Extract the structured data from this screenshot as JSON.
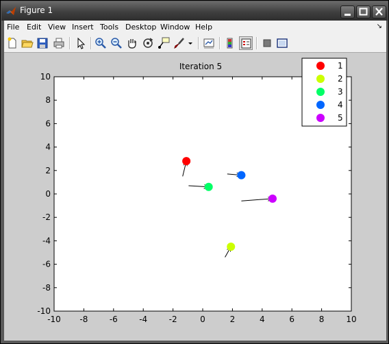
{
  "window": {
    "title": "Figure 1"
  },
  "menubar": {
    "items": [
      "File",
      "Edit",
      "View",
      "Insert",
      "Tools",
      "Desktop",
      "Window",
      "Help"
    ]
  },
  "toolbar": {
    "buttons": [
      "new-figure",
      "open-file",
      "save-figure",
      "print-figure",
      "edit-plot",
      "zoom-in",
      "zoom-out",
      "pan",
      "rotate-3d",
      "data-cursor",
      "brush",
      "brush-dropdown",
      "link-plot",
      "insert-colorbar",
      "insert-legend",
      "hide-plot-tools",
      "show-plot-tools"
    ]
  },
  "chart_data": {
    "type": "scatter",
    "title": "Iteration 5",
    "xlabel": "",
    "ylabel": "",
    "xlim": [
      -10,
      10
    ],
    "ylim": [
      -10,
      10
    ],
    "xticks": [
      -10,
      -8,
      -6,
      -4,
      -2,
      0,
      2,
      4,
      6,
      8,
      10
    ],
    "yticks": [
      -10,
      -8,
      -6,
      -4,
      -2,
      0,
      2,
      4,
      6,
      8,
      10
    ],
    "grid": false,
    "legend_position": "top-right",
    "series": [
      {
        "name": "1",
        "color": "#ff0000",
        "x": -1.1,
        "y": 2.8,
        "arrow_from": [
          -1.35,
          1.5
        ]
      },
      {
        "name": "2",
        "color": "#ccff00",
        "x": 1.9,
        "y": -4.5,
        "arrow_from": [
          1.5,
          -5.4
        ]
      },
      {
        "name": "3",
        "color": "#00ff66",
        "x": 0.4,
        "y": 0.6,
        "arrow_from": [
          -0.95,
          0.7
        ]
      },
      {
        "name": "4",
        "color": "#0066ff",
        "x": 2.6,
        "y": 1.6,
        "arrow_from": [
          1.65,
          1.7
        ]
      },
      {
        "name": "5",
        "color": "#cc00ff",
        "x": 4.7,
        "y": -0.4,
        "arrow_from": [
          2.6,
          -0.6
        ]
      }
    ]
  }
}
